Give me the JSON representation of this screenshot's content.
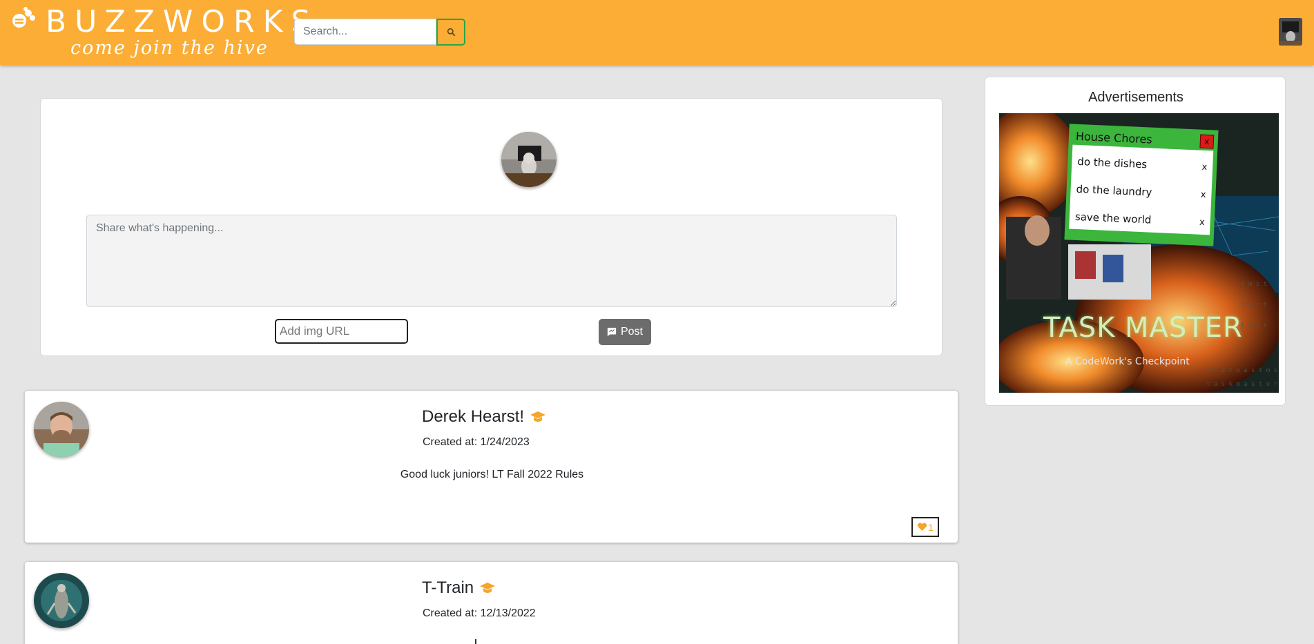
{
  "header": {
    "brand_title": "BUZZWORKS",
    "brand_tagline": "come join the hive",
    "search_placeholder": "Search...",
    "accent_color": "#fbad35",
    "search_button_icon": "search-icon"
  },
  "composer": {
    "text_placeholder": "Share what's happening...",
    "img_url_placeholder": "Add img URL",
    "post_label": "Post",
    "post_icon": "chat-icon"
  },
  "posts": [
    {
      "author": "Derek Hearst!",
      "badge_icon": "graduation-cap-icon",
      "created": "Created at: 1/24/2023",
      "body": "Good luck juniors! LT Fall 2022 Rules",
      "likes": "1",
      "like_icon": "heart-icon"
    },
    {
      "author": "T-Train",
      "badge_icon": "graduation-cap-icon",
      "created": "Created at: 12/13/2022"
    }
  ],
  "ads": {
    "title": "Advertisements",
    "chores_title": "House Chores",
    "chores_close": "x",
    "chores": [
      {
        "label": "do the dishes",
        "remove": "x"
      },
      {
        "label": "do the laundry",
        "remove": "x"
      },
      {
        "label": "save the world",
        "remove": "x"
      }
    ],
    "ad_title": "TASK MASTER",
    "ad_subtitle": "A CodeWork's Checkpoint"
  }
}
